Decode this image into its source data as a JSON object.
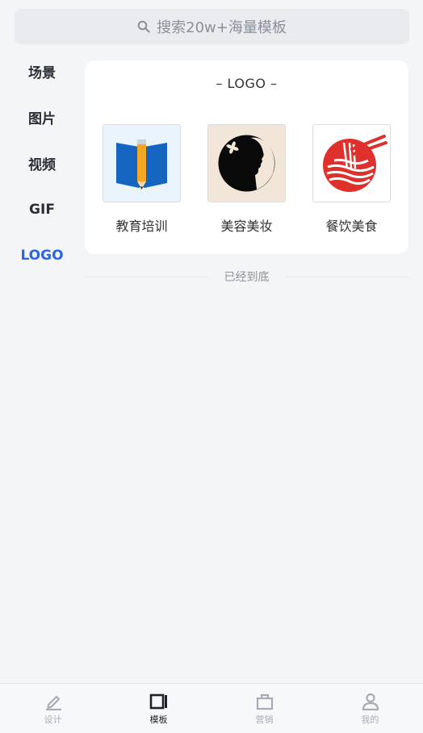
{
  "search": {
    "placeholder": "搜索20w+海量模板"
  },
  "sidebar": {
    "items": [
      {
        "label": "场景"
      },
      {
        "label": "图片"
      },
      {
        "label": "视频"
      },
      {
        "label": "GIF"
      },
      {
        "label": "LOGO"
      }
    ],
    "active": "LOGO"
  },
  "panel": {
    "title": "– LOGO –",
    "cards": [
      {
        "label": "教育培训",
        "icon": "book-pencil-icon"
      },
      {
        "label": "美容美妆",
        "icon": "woman-silhouette-icon"
      },
      {
        "label": "餐饮美食",
        "icon": "noodle-bowl-icon"
      }
    ]
  },
  "end_note": "已经到底",
  "tabbar": {
    "tabs": [
      {
        "label": "设计",
        "icon": "pen-icon"
      },
      {
        "label": "模板",
        "icon": "template-icon"
      },
      {
        "label": "营销",
        "icon": "briefcase-icon"
      },
      {
        "label": "我的",
        "icon": "user-icon"
      }
    ],
    "active": "模板"
  },
  "colors": {
    "accent": "#2a64e8",
    "background": "#f4f5f7",
    "logo_red": "#e0302b",
    "logo_blue": "#1565c0"
  }
}
